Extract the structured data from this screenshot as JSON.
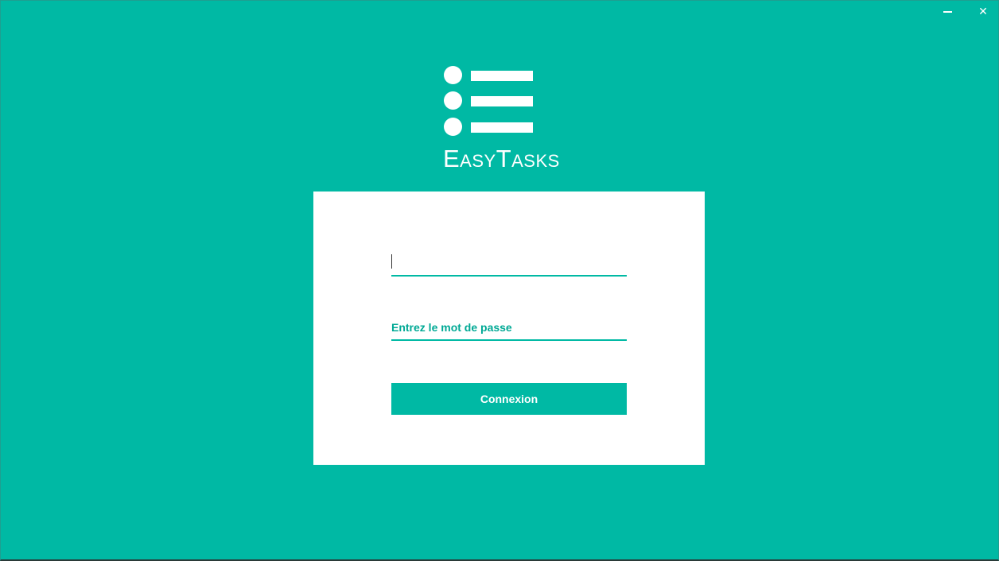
{
  "window": {
    "minimize_icon": "minimize-icon",
    "close_icon": "close-icon",
    "close_glyph": "✕"
  },
  "app": {
    "name": "EasyTasks",
    "logo_icon": "task-list-icon"
  },
  "login": {
    "username_value": "",
    "username_placeholder": "",
    "password_value": "",
    "password_placeholder": "Entrez le mot de passe",
    "submit_label": "Connexion"
  },
  "colors": {
    "background": "#00b9a4",
    "card": "#ffffff",
    "accent": "#00b9a4",
    "text_on_accent": "#ffffff"
  }
}
